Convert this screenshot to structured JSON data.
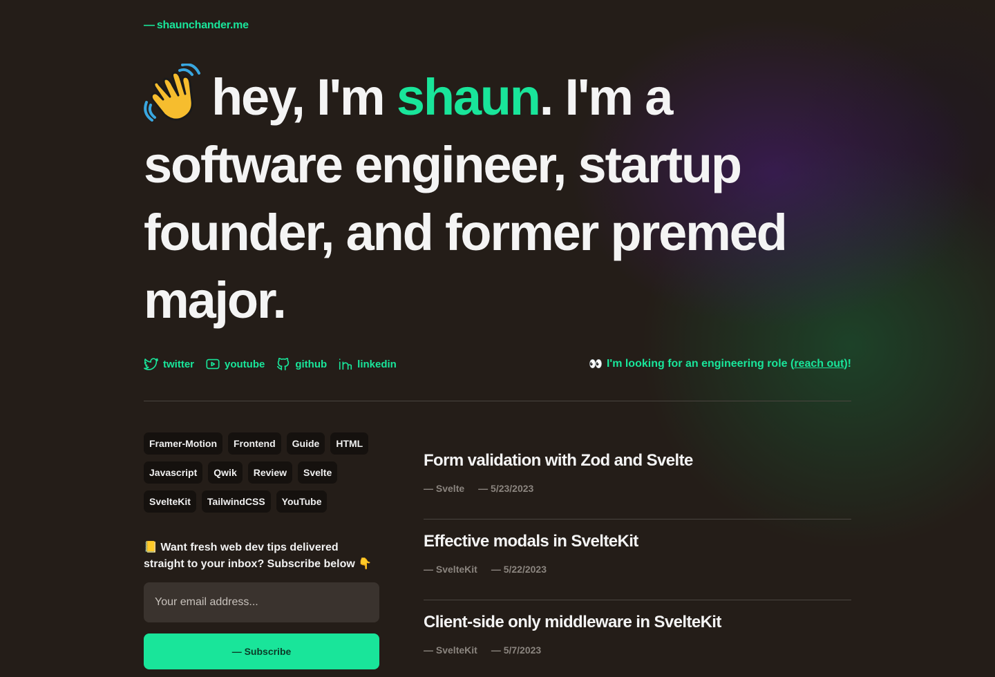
{
  "brand": {
    "dash": "—",
    "label": "shaunchander.me"
  },
  "hero": {
    "wave": "wave-emoji",
    "part1": "hey, I'm ",
    "name": "shaun",
    "part2": ". I'm a software engineer, startup founder, and former premed major."
  },
  "socials": [
    {
      "label": "twitter",
      "icon": "twitter-icon"
    },
    {
      "label": "youtube",
      "icon": "youtube-icon"
    },
    {
      "label": "github",
      "icon": "github-icon"
    },
    {
      "label": "linkedin",
      "icon": "linkedin-icon"
    }
  ],
  "hiring": {
    "emoji": "👀",
    "text": "I'm looking for an engineering role ",
    "open": "(",
    "link": "reach out",
    "close": ")!"
  },
  "tags": [
    "Framer-Motion",
    "Frontend",
    "Guide",
    "HTML",
    "Javascript",
    "Qwik",
    "Review",
    "Svelte",
    "SvelteKit",
    "TailwindCSS",
    "YouTube"
  ],
  "newsletter": {
    "emoji_start": "📒",
    "text": "Want fresh web dev tips delivered straight to your inbox? Subscribe below",
    "emoji_end": "👇",
    "placeholder": "Your email address...",
    "button": "— Subscribe"
  },
  "posts": [
    {
      "title": "Form validation with Zod and Svelte",
      "tag": "— Svelte",
      "date": "— 5/23/2023"
    },
    {
      "title": "Effective modals in SvelteKit",
      "tag": "— SvelteKit",
      "date": "— 5/22/2023"
    },
    {
      "title": "Client-side only middleware in SvelteKit",
      "tag": "— SvelteKit",
      "date": "— 5/7/2023"
    }
  ],
  "colors": {
    "accent": "#19e59a",
    "background": "#241d18"
  }
}
